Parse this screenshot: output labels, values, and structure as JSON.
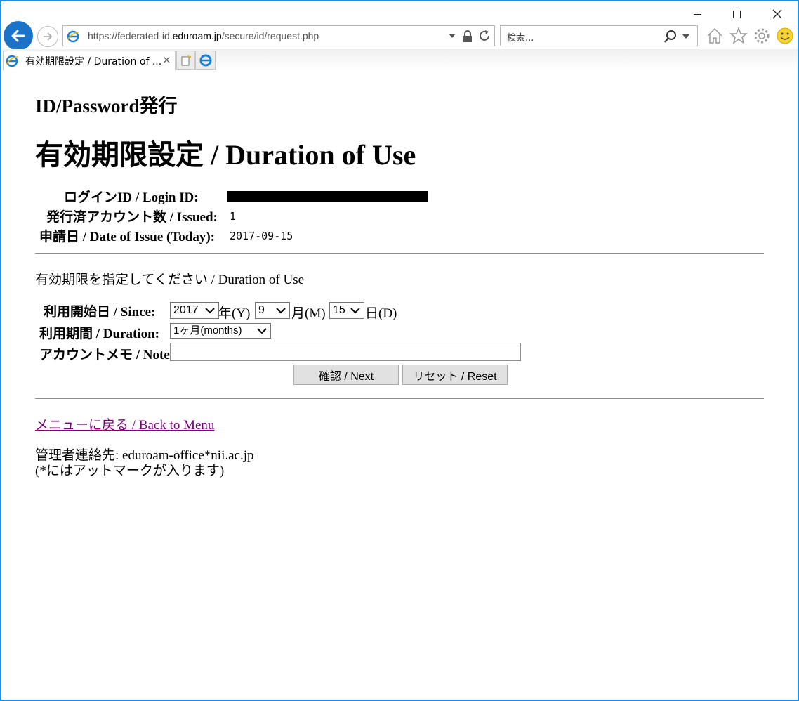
{
  "browser": {
    "address_url_prefix": "https://federated-id.",
    "address_url_domain": "eduroam.jp",
    "address_url_path": "/secure/id/request.php",
    "search_placeholder": "検索...",
    "tab_title": "有効期限設定 / Duration of ...",
    "tab_close": "×"
  },
  "page": {
    "subtitle": "ID/Password発行",
    "title": "有効期限設定 / Duration of Use"
  },
  "info": {
    "login_id_label": "ログインID / Login ID:",
    "issued_label": "発行済アカウント数 / Issued:",
    "issued_value": "1",
    "date_label": "申請日 / Date of Issue (Today):",
    "date_value": "2017-09-15"
  },
  "form": {
    "intro": "有効期限を指定してください / Duration of Use",
    "since_label": "利用開始日 / Since:",
    "year_value": "2017",
    "year_unit": "年(Y)",
    "month_value": "9",
    "month_unit": "月(M)",
    "day_value": "15",
    "day_unit": "日(D)",
    "duration_label": "利用期間 / Duration:",
    "duration_value": "1ヶ月(months)",
    "note_label": "アカウントメモ / Note:",
    "note_value": "",
    "next_button": "確認 / Next",
    "reset_button": "リセット / Reset"
  },
  "footer": {
    "menu_link": "メニューに戻る / Back to Menu",
    "contact_line1": "管理者連絡先: eduroam-office*nii.ac.jp",
    "contact_line2": "(*にはアットマークが入ります)"
  },
  "colors": {
    "window_border": "#1e90e0",
    "back_button": "#1a73c9",
    "visited_link": "#800080"
  }
}
